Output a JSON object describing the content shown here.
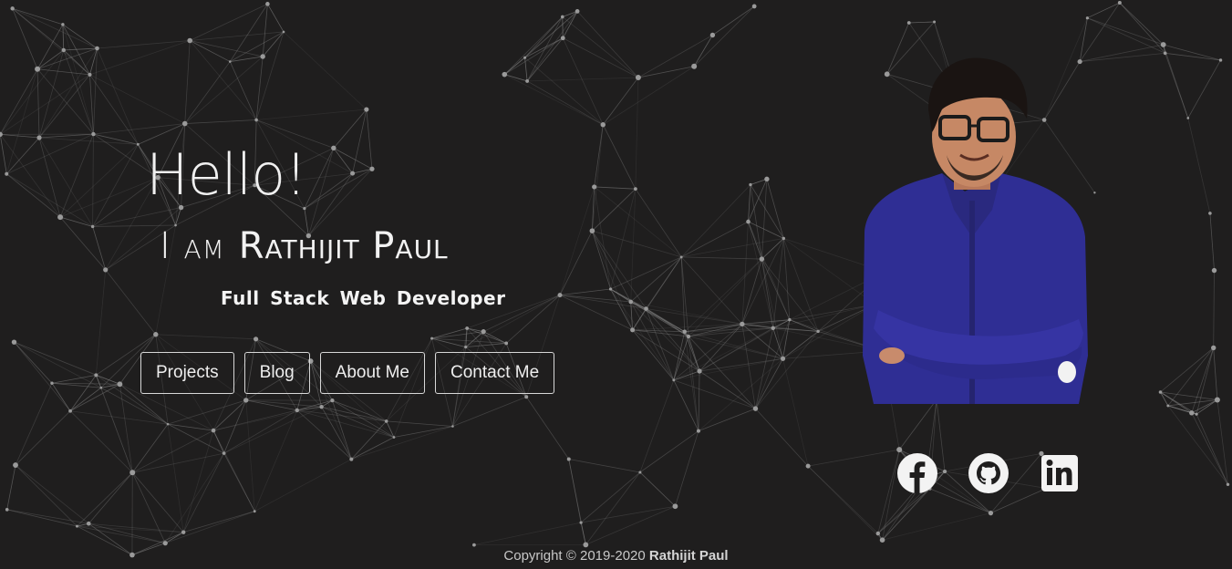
{
  "hero": {
    "greeting": "Hello!",
    "intro_prefix": "I am",
    "name": "Rathijit Paul",
    "role": "Full Stack Web Developer"
  },
  "nav": [
    {
      "label": "Projects"
    },
    {
      "label": "Blog"
    },
    {
      "label": "About Me"
    },
    {
      "label": "Contact Me"
    }
  ],
  "social": [
    {
      "icon": "facebook-icon"
    },
    {
      "icon": "github-icon"
    },
    {
      "icon": "linkedin-icon"
    }
  ],
  "footer": {
    "copyright": "Copyright © 2019-2020",
    "owner": "Rathijit Paul"
  },
  "colors": {
    "background": "#1f1e1e",
    "text": "#eeeeee",
    "shirt": "#2f2e94",
    "network_line": "#8a8a8a"
  }
}
